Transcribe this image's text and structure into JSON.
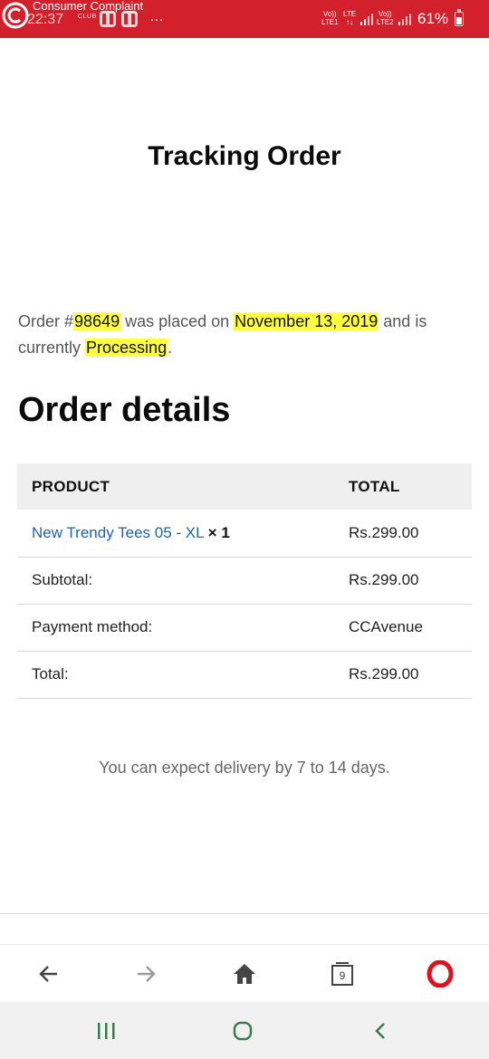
{
  "status_bar": {
    "app_name": "Consumer Complaint",
    "time": "22:37",
    "club_text": "CLUB",
    "dots": "…",
    "sim1": "Vo))\nLTE1",
    "lte": "LTE\n↑↓",
    "sim2": "Vo))\nLTE2",
    "battery_pct": "61%",
    "bar_color": "#d3202d"
  },
  "page": {
    "title": "Tracking Order",
    "summary": {
      "prefix": "Order #",
      "order_number": "98649",
      "placed_text": " was placed on ",
      "date": "November 13, 2019",
      "status_text": " and is currently ",
      "status": "Processing",
      "suffix": "."
    },
    "details_heading": "Order details",
    "table": {
      "headers": {
        "product": "PRODUCT",
        "total": "TOTAL"
      },
      "item": {
        "name": "New Trendy Tees 05 - XL",
        "qty": "× 1",
        "total": "Rs.299.00"
      },
      "rows": [
        {
          "label": "Subtotal:",
          "value": "Rs.299.00"
        },
        {
          "label": "Payment method:",
          "value": "CCAvenue"
        },
        {
          "label": "Total:",
          "value": "Rs.299.00"
        }
      ]
    },
    "delivery_note": "You can expect delivery by 7 to 14 days.",
    "highlight_color": "#ffff3d",
    "link_color": "#1a63b5"
  },
  "browser_bar": {
    "tab_count": "9",
    "icons": [
      "back-arrow-icon",
      "forward-arrow-icon",
      "home-icon",
      "tabs-icon",
      "opera-icon"
    ]
  },
  "android_nav": {
    "icons": [
      "recent-apps-icon",
      "home-circle-icon",
      "back-chevron-icon"
    ]
  }
}
